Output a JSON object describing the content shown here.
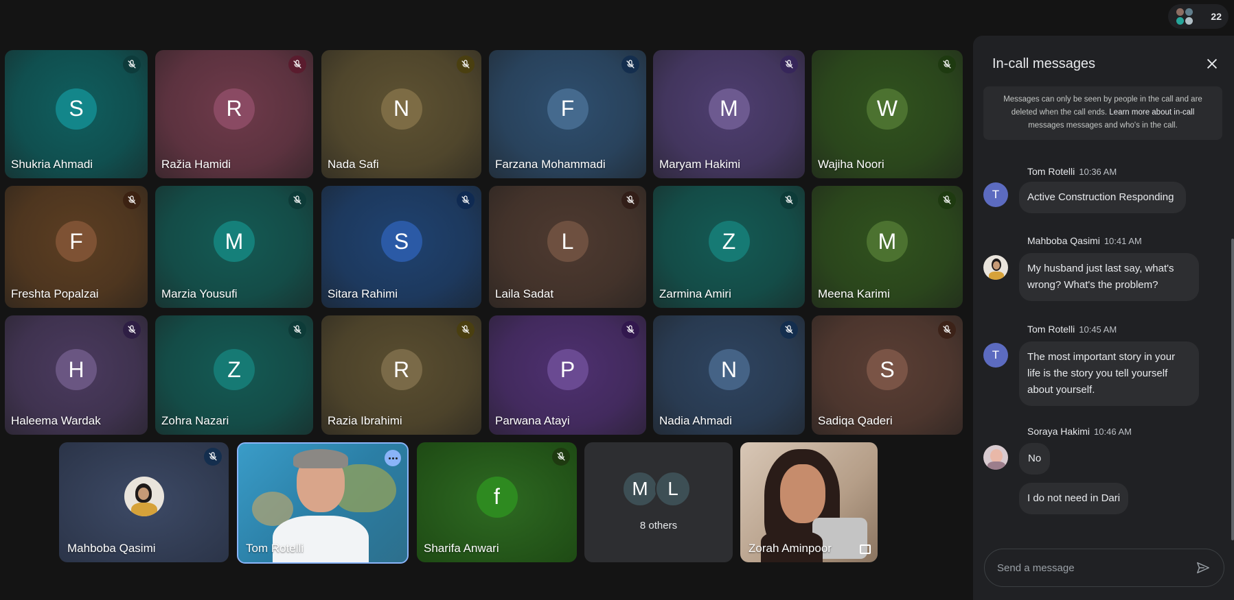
{
  "participant_count": "22",
  "tiles": [
    {
      "name": "Shukria Ahmadi",
      "initial": "S",
      "bg": "#0f5e5e",
      "avatar": "#13868a",
      "mic_bg": "#0d3b3b"
    },
    {
      "name": "Ražia Hamidi",
      "initial": "R",
      "bg": "#6e3a4a",
      "avatar": "#8a4a63",
      "mic_bg": "#5a1c2e"
    },
    {
      "name": "Nada Safi",
      "initial": "N",
      "bg": "#5e5232",
      "avatar": "#7d6c45",
      "mic_bg": "#4a3f10"
    },
    {
      "name": "Farzana Mohammadi",
      "initial": "F",
      "bg": "#2e4e6e",
      "avatar": "#456a8e",
      "mic_bg": "#142e4e"
    },
    {
      "name": "Maryam Hakimi",
      "initial": "M",
      "bg": "#4e3e70",
      "avatar": "#6d5a90",
      "mic_bg": "#36265a"
    },
    {
      "name": "Wajiha Noori",
      "initial": "W",
      "bg": "#30521e",
      "avatar": "#4c7230",
      "mic_bg": "#1e3a10"
    },
    {
      "name": "Freshta Popalzai",
      "initial": "F",
      "bg": "#5c3e22",
      "avatar": "#7e5234",
      "mic_bg": "#3c2212"
    },
    {
      "name": "Marzia Yousufi",
      "initial": "M",
      "bg": "#145a54",
      "avatar": "#15807a",
      "mic_bg": "#0d3b38"
    },
    {
      "name": "Sitara Rahimi",
      "initial": "S",
      "bg": "#1f4270",
      "avatar": "#2b5aa6",
      "mic_bg": "#0f2a52"
    },
    {
      "name": "Laila Sadat",
      "initial": "L",
      "bg": "#4e3a30",
      "avatar": "#6e5040",
      "mic_bg": "#321e18"
    },
    {
      "name": "Zarmina Amiri",
      "initial": "Z",
      "bg": "#145a54",
      "avatar": "#167a74",
      "mic_bg": "#0d3b38"
    },
    {
      "name": "Meena Karimi",
      "initial": "M",
      "bg": "#30521e",
      "avatar": "#4c7230",
      "mic_bg": "#1e3a10"
    },
    {
      "name": "Haleema Wardak",
      "initial": "H",
      "bg": "#4a3a5e",
      "avatar": "#6a5682",
      "mic_bg": "#2e1e44"
    },
    {
      "name": "Zohra Nazari",
      "initial": "Z",
      "bg": "#145a54",
      "avatar": "#167a74",
      "mic_bg": "#0d3b38"
    },
    {
      "name": "Razia Ibrahimi",
      "initial": "R",
      "bg": "#5a4e30",
      "avatar": "#7a6a48",
      "mic_bg": "#4a3f10"
    },
    {
      "name": "Parwana Atayi",
      "initial": "P",
      "bg": "#4e3070",
      "avatar": "#6a4a92",
      "mic_bg": "#32184e"
    },
    {
      "name": "Nadia Ahmadi",
      "initial": "N",
      "bg": "#2e4460",
      "avatar": "#456386",
      "mic_bg": "#142e4e"
    },
    {
      "name": "Sadiqa Qaderi",
      "initial": "S",
      "bg": "#5a3e34",
      "avatar": "#7a5446",
      "mic_bg": "#3c2218"
    }
  ],
  "bottom_tiles": {
    "mahboba": {
      "name": "Mahboba Qasimi"
    },
    "tom": {
      "name": "Tom Rotelli"
    },
    "sharifa": {
      "name": "Sharifa Anwari",
      "initial": "f"
    },
    "others": {
      "label": "8 others",
      "initial_1": "M",
      "initial_2": "L"
    },
    "zorah": {
      "name": "Zorah Aminpoor"
    }
  },
  "chat": {
    "title": "In-call messages",
    "notice_1": "Messages can only be seen by people in the call and are",
    "notice_2a": "deleted when the call ends. ",
    "notice_2b": "Learn more about in-call",
    "notice_3": "messages messages and who's in the call.",
    "messages": [
      {
        "sender": "Tom Rotelli",
        "time": "10:36 AM",
        "initial": "T",
        "lines": [
          "Active Construction Responding"
        ]
      },
      {
        "sender": "Mahboba Qasimi",
        "time": "10:41 AM",
        "initial": "",
        "lines": [
          "My husband just last say,  what's",
          "wrong? What's the problem?"
        ]
      },
      {
        "sender": "Tom Rotelli",
        "time": "10:45 AM",
        "initial": "T",
        "lines": [
          "The most important story in your",
          "life is the story you tell yourself",
          "about yourself."
        ]
      },
      {
        "sender": "Soraya Hakimi",
        "time": "10:46 AM",
        "initial": "",
        "lines": [
          "No"
        ],
        "extra": "I do not need in Dari"
      }
    ],
    "input_placeholder": "Send a message"
  },
  "colors": {
    "accent_blue": "#8ab4f8",
    "chat_avatar": "#5c6bc0"
  }
}
